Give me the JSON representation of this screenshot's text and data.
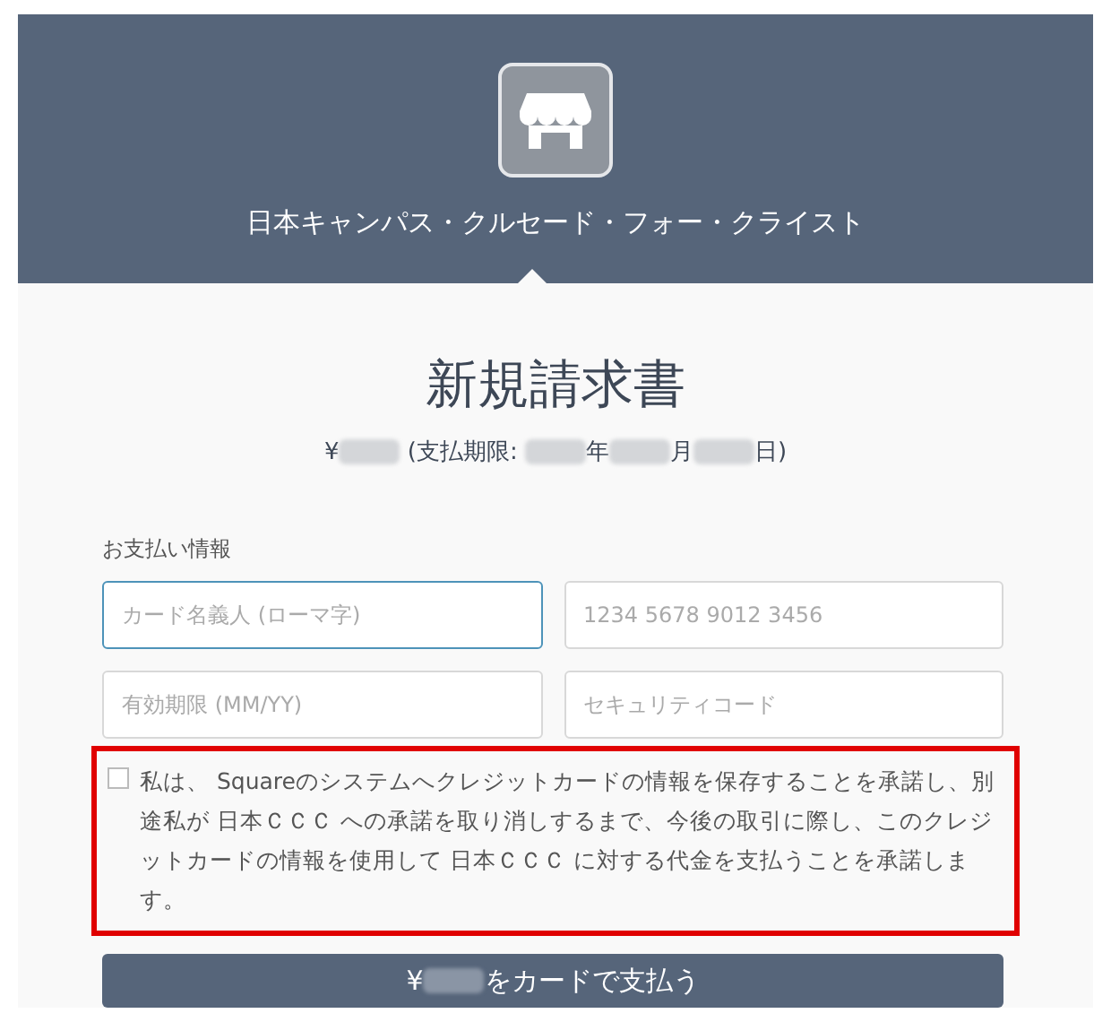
{
  "header": {
    "merchant_name": "日本キャンパス・クルセード・フォー・クライスト"
  },
  "invoice": {
    "title": "新規請求書",
    "summary": [
      {
        "kind": "text",
        "text": "¥"
      },
      {
        "kind": "redacted"
      },
      {
        "kind": "text",
        "text": " (支払期限: "
      },
      {
        "kind": "redacted"
      },
      {
        "kind": "text",
        "text": "年"
      },
      {
        "kind": "redacted"
      },
      {
        "kind": "text",
        "text": "月"
      },
      {
        "kind": "redacted"
      },
      {
        "kind": "text",
        "text": "日)"
      }
    ]
  },
  "payment": {
    "label": "お支払い情報",
    "fields": [
      {
        "placeholder": "カード名義人 (ローマ字)",
        "focused": true
      },
      {
        "placeholder": "1234 5678 9012 3456",
        "focused": false
      },
      {
        "placeholder": "有効期限 (MM/YY)",
        "focused": false
      },
      {
        "placeholder": "セキュリティコード",
        "focused": false
      }
    ],
    "consent": {
      "checked": false,
      "highlighted": true,
      "text": "私は、 Squareのシステムへクレジットカードの情報を保存することを承諾し、別途私が 日本ＣＣＣ への承諾を取り消しするまで、今後の取引に際し、このクレジットカードの情報を使用して 日本ＣＣＣ に対する代金を支払うことを承諾します。"
    },
    "pay_button": [
      {
        "kind": "text",
        "text": "¥"
      },
      {
        "kind": "redacted"
      },
      {
        "kind": "text",
        "text": "をカードで支払う"
      }
    ]
  }
}
